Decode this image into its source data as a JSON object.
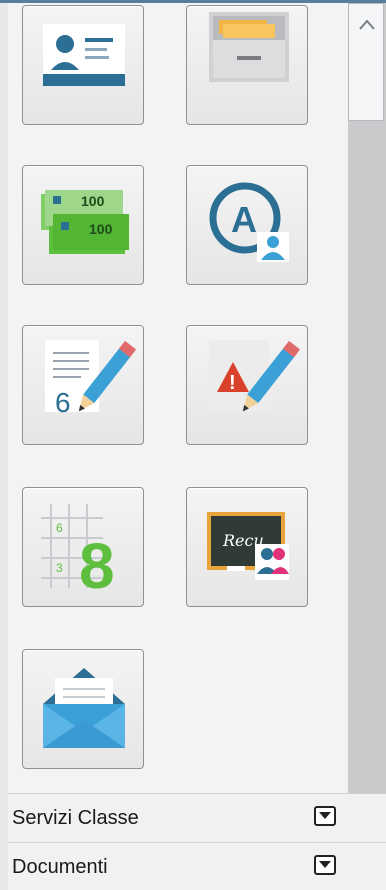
{
  "tiles": [
    {
      "icon": "id-card-icon"
    },
    {
      "icon": "file-cabinet-icon"
    },
    {
      "icon": "money-banknotes-icon",
      "text_a": "100",
      "text_b": "100"
    },
    {
      "icon": "letter-a-user-icon",
      "letter": "A"
    },
    {
      "icon": "grade-pencil-icon",
      "digit": "6"
    },
    {
      "icon": "warning-pencil-icon",
      "mark": "!"
    },
    {
      "icon": "grade-grid-icon",
      "small_a": "6",
      "small_b": "3",
      "big": "8"
    },
    {
      "icon": "blackboard-recovery-icon",
      "board_text": "Recu"
    },
    {
      "icon": "envelope-icon"
    }
  ],
  "sections": [
    {
      "label": "Servizi Classe"
    },
    {
      "label": "Documenti"
    }
  ],
  "colors": {
    "accent": "#2b6f94",
    "green": "#5ebf3f",
    "red": "#d9412a",
    "orange": "#e8a33a"
  }
}
